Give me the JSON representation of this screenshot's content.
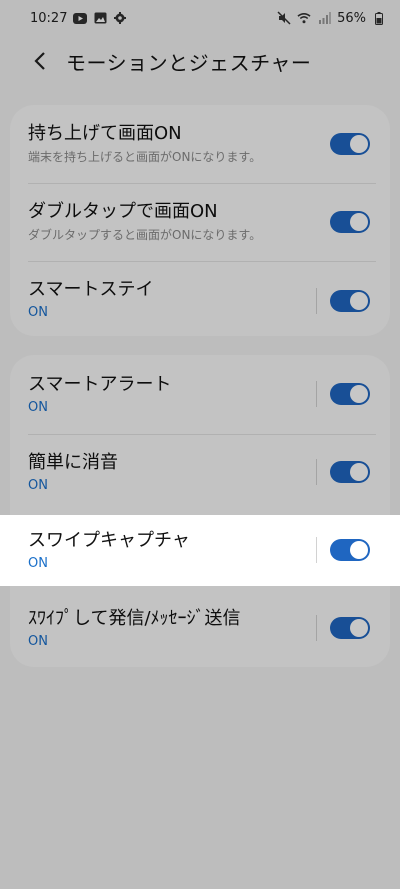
{
  "status_bar": {
    "time": "10:27",
    "battery": "56%"
  },
  "header": {
    "back_icon": "chevron-left-icon",
    "title": "モーションとジェスチャー"
  },
  "group1": [
    {
      "title": "持ち上げて画面ON",
      "subtitle": "端末を持ち上げると画面がONになります。",
      "enabled": true
    },
    {
      "title": "ダブルタップで画面ON",
      "subtitle": "ダブルタップすると画面がONになります。",
      "enabled": true
    },
    {
      "title": "スマートステイ",
      "status": "ON",
      "enabled": true
    }
  ],
  "group2": [
    {
      "title": "スマートアラート",
      "status": "ON",
      "enabled": true
    },
    {
      "title": "簡単に消音",
      "status": "ON",
      "enabled": true
    },
    {
      "title": "スワイプキャプチャ",
      "status": "ON",
      "enabled": true
    },
    {
      "title": "ｽﾜｲﾌﾟして発信/ﾒｯｾｰｼﾞ送信",
      "status": "ON",
      "enabled": true
    }
  ],
  "colors": {
    "accent": "#1f66c1",
    "status_text": "#1a6fc9"
  }
}
